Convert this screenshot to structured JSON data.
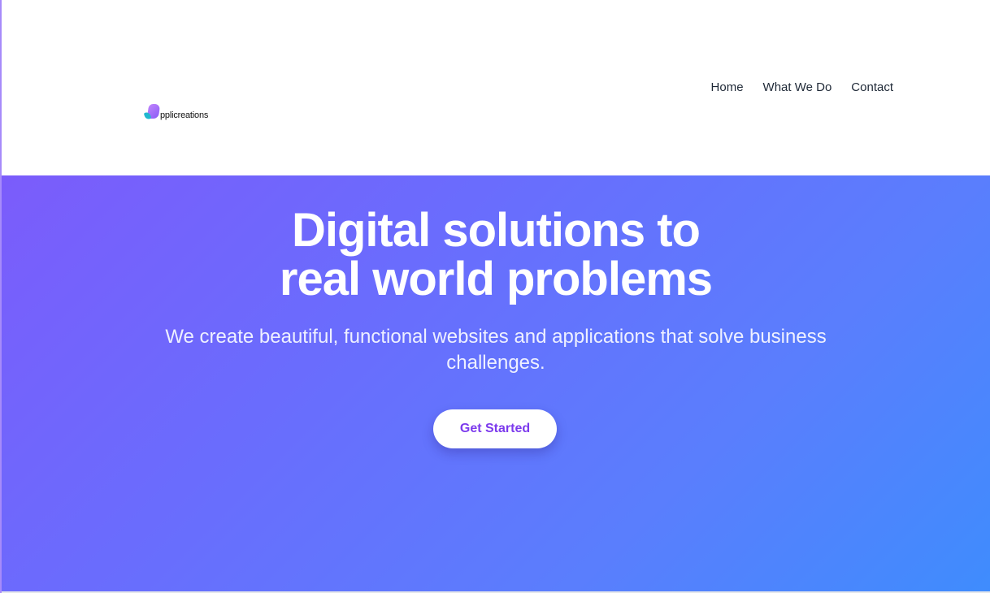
{
  "header": {
    "logo_text": "pplicreations",
    "nav": [
      {
        "label": "Home"
      },
      {
        "label": "What We Do"
      },
      {
        "label": "Contact"
      }
    ]
  },
  "hero": {
    "title_line_1": "Digital solutions to",
    "title_line_2": "real world problems",
    "subtitle": "We create beautiful, functional websites and applications that solve business challenges.",
    "cta_label": "Get Started"
  },
  "colors": {
    "hero_gradient_start": "#7b5cfb",
    "hero_gradient_end": "#3f8cfd",
    "cta_text": "#7c3aed",
    "logo_purple": "#8b5cf6",
    "logo_teal": "#22b8cf"
  }
}
